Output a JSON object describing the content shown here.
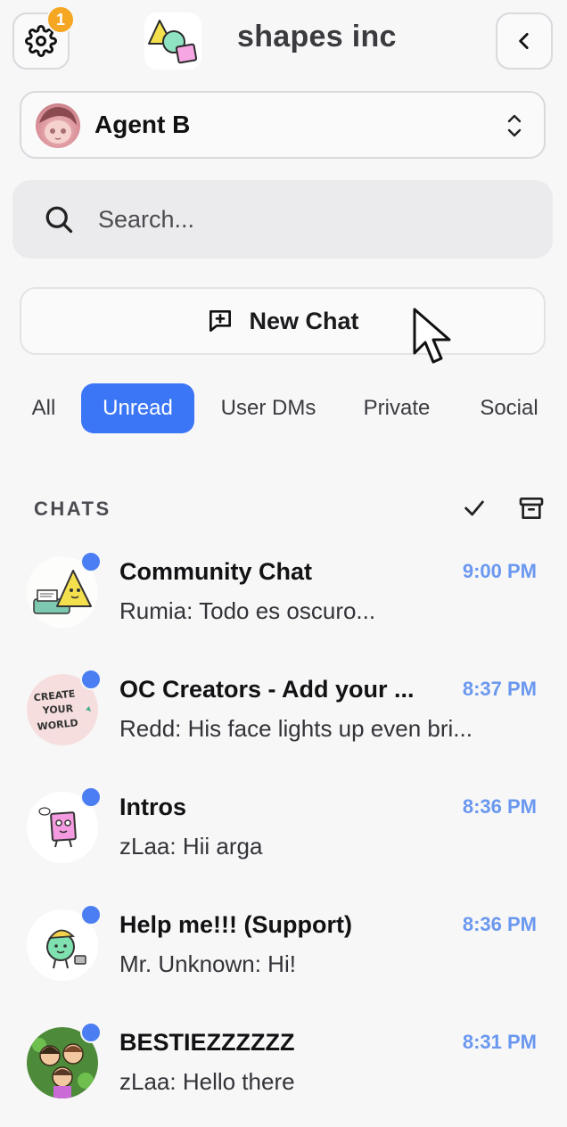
{
  "header": {
    "title": "shapes inc",
    "settings_badge": "1"
  },
  "agent": {
    "name": "Agent B"
  },
  "search": {
    "placeholder": "Search..."
  },
  "new_chat": {
    "label": "New Chat"
  },
  "tabs": [
    {
      "label": "All",
      "active": false
    },
    {
      "label": "Unread",
      "active": true
    },
    {
      "label": "User DMs",
      "active": false
    },
    {
      "label": "Private",
      "active": false
    },
    {
      "label": "Social",
      "active": false
    }
  ],
  "chats_section": {
    "title": "CHATS"
  },
  "chats": [
    {
      "name": "Community Chat",
      "time": "9:00 PM",
      "preview": "Rumia: Todo es oscuro...",
      "unread": true,
      "avatar_icon": "typewriter-triangle-icon"
    },
    {
      "name": "OC Creators - Add your ...",
      "time": "8:37 PM",
      "preview": "Redd: His face lights up even bri...",
      "unread": true,
      "avatar_icon": "create-your-world-icon"
    },
    {
      "name": "Intros",
      "time": "8:36 PM",
      "preview": "zLaa: Hii arga",
      "unread": true,
      "avatar_icon": "pink-square-character-icon"
    },
    {
      "name": "Help me!!! (Support)",
      "time": "8:36 PM",
      "preview": "Mr. Unknown: Hi!",
      "unread": true,
      "avatar_icon": "green-helper-character-icon"
    },
    {
      "name": "BESTIEZZZZZZ",
      "time": "8:31 PM",
      "preview": "zLaa: Hello there",
      "unread": true,
      "avatar_icon": "friends-group-icon"
    }
  ],
  "colors": {
    "accent": "#3b76f6",
    "unread_dot": "#4c7ef3",
    "time": "#6a98ef",
    "badge": "#f5a623"
  }
}
